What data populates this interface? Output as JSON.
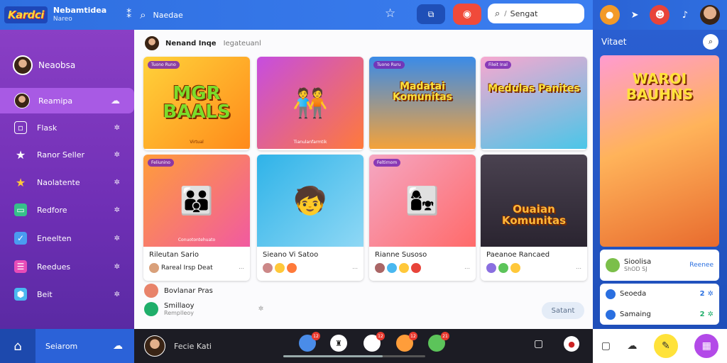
{
  "app": {
    "logo": "Kardci",
    "brand_title": "Nebamtidea",
    "brand_sub": "Nareo",
    "header_title": "Naedae",
    "search_placeholder": "Sengat",
    "search_slash": "/"
  },
  "sidebar": {
    "profile_name": "Neaobsa",
    "items": [
      {
        "label": "Reamipa",
        "icon": "chat-icon"
      },
      {
        "label": "Flask",
        "icon": "square-icon"
      },
      {
        "label": "Ranor Seller",
        "icon": "star-icon"
      },
      {
        "label": "Naolatente",
        "icon": "star-icon"
      },
      {
        "label": "Redfore",
        "icon": "screen-icon"
      },
      {
        "label": "Eneelten",
        "icon": "checklist-icon"
      },
      {
        "label": "Reedues",
        "icon": "list-icon"
      },
      {
        "label": "Beit",
        "icon": "shield-icon"
      }
    ]
  },
  "feed": {
    "header_title": "Nenand Inqe",
    "header_sub": "Iegateuanl",
    "cards": [
      {
        "tag": "Tuono Runo",
        "title": "MGR BAALS",
        "caption": "Virtual",
        "colors": [
          "#ffd23a",
          "#ff8a1a"
        ]
      },
      {
        "tag": "",
        "title": "",
        "caption": "Tianulanfarmtik",
        "colors": [
          "#c64de0",
          "#ff7a3a"
        ]
      },
      {
        "tag": "Tuono Ruru",
        "title": "Madatai Komunitas",
        "caption": "",
        "colors": [
          "#3a8be8",
          "#ffd23a"
        ]
      },
      {
        "tag": "Fileit Inal",
        "title": "Medulas Panites",
        "caption": "",
        "colors": [
          "#f7a8d0",
          "#4ac6e8"
        ]
      },
      {
        "tag": "Feliunino",
        "title": "",
        "caption": "Conuotontehuato",
        "colors": [
          "#ff9d3a",
          "#f15aa0"
        ],
        "card_title": "Rileutan Sario",
        "meta": "Rareal Irsp Deat"
      },
      {
        "tag": "",
        "title": "",
        "caption": "",
        "colors": [
          "#2fb3e8",
          "#8fd8f5"
        ],
        "card_title": "Sieano Vi Satoo",
        "meta": ""
      },
      {
        "tag": "Feltirnom",
        "title": "",
        "caption": "",
        "colors": [
          "#f5a7c3",
          "#ff6a6a"
        ],
        "card_title": "Rianne Susoso",
        "meta": ""
      },
      {
        "tag": "",
        "title": "Ouaian Komunitas",
        "caption": "",
        "colors": [
          "#4a4250",
          "#2a2430"
        ],
        "card_title": "Paeanoe Rancaed",
        "meta": ""
      }
    ],
    "list": [
      {
        "label": "Bovlanar Pras",
        "sub": ""
      },
      {
        "label": "Smillaoy",
        "sub": "Remplleoy"
      }
    ],
    "load_more": "Satant"
  },
  "right_panel": {
    "title": "Vitaet",
    "poster_title": "WAROI BAUHNS",
    "card1_title": "Sioolisa",
    "card1_sub": "ShOD SJ",
    "card1_action": "Reenee",
    "row1_label": "Seoeda",
    "row1_value": "2",
    "row2_label": "Samaing",
    "row2_value": "2"
  },
  "bottom": {
    "home_label": "Seiarom",
    "mid_label": "Fecie Kati",
    "progress": 0.7,
    "badges": [
      "12",
      "",
      "12",
      "12",
      "21"
    ]
  },
  "colors": {
    "top_bar": "#2f6fe0",
    "sidebar": "#7a35ba",
    "accent": "#a85ae4",
    "record": "#f04a3a"
  }
}
